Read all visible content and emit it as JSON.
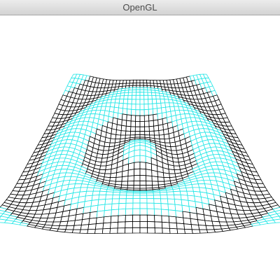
{
  "window": {
    "title": "OpenGL"
  },
  "scene": {
    "description_type": "wireframe-mesh",
    "grid_color_a": "#000000",
    "grid_color_b": "#22e6e6",
    "background": "#ffffff"
  }
}
